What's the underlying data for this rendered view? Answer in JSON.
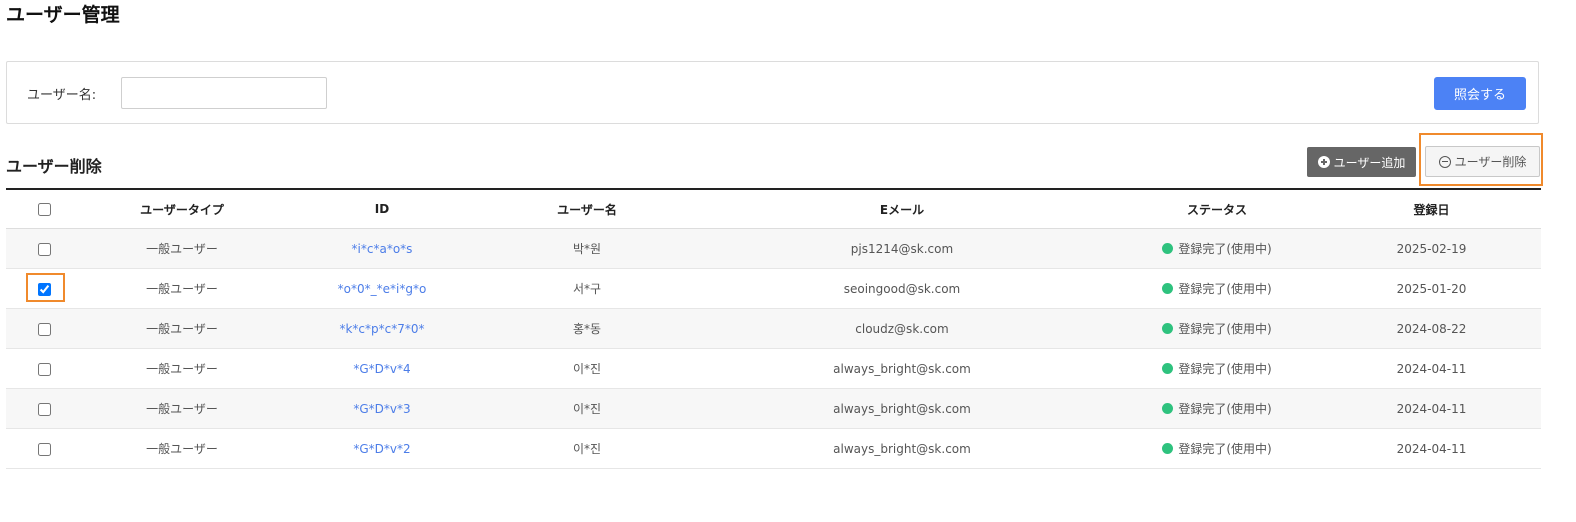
{
  "page_title": "ユーザー管理",
  "search": {
    "label": "ユーザー名:",
    "value": "",
    "placeholder": "",
    "button_label": "照会する"
  },
  "section": {
    "title": "ユーザー削除",
    "add_button_label": "ユーザー追加",
    "delete_button_label": "ユーザー削除"
  },
  "table": {
    "headers": {
      "user_type": "ユーザータイプ",
      "id": "ID",
      "user_name": "ユーザー名",
      "email": "Eメール",
      "status": "ステータス",
      "registered": "登録日"
    },
    "rows": [
      {
        "checked": false,
        "user_type": "一般ユーザー",
        "id": "*i*c*a*o*s",
        "user_name": "박*원",
        "email": "pjs1214@sk.com",
        "status": "登録完了(使用中)",
        "registered": "2025-02-19"
      },
      {
        "checked": true,
        "user_type": "一般ユーザー",
        "id": "*o*0*_*e*i*g*o",
        "user_name": "서*구",
        "email": "seoingood@sk.com",
        "status": "登録完了(使用中)",
        "registered": "2025-01-20"
      },
      {
        "checked": false,
        "user_type": "一般ユーザー",
        "id": "*k*c*p*c*7*0*",
        "user_name": "홍*동",
        "email": "cloudz@sk.com",
        "status": "登録完了(使用中)",
        "registered": "2024-08-22"
      },
      {
        "checked": false,
        "user_type": "一般ユーザー",
        "id": "*G*D*v*4",
        "user_name": "이*진",
        "email": "always_bright@sk.com",
        "status": "登録完了(使用中)",
        "registered": "2024-04-11"
      },
      {
        "checked": false,
        "user_type": "一般ユーザー",
        "id": "*G*D*v*3",
        "user_name": "이*진",
        "email": "always_bright@sk.com",
        "status": "登録完了(使用中)",
        "registered": "2024-04-11"
      },
      {
        "checked": false,
        "user_type": "一般ユーザー",
        "id": "*G*D*v*2",
        "user_name": "이*진",
        "email": "always_bright@sk.com",
        "status": "登録完了(使用中)",
        "registered": "2024-04-11"
      }
    ]
  },
  "colors": {
    "primary_button": "#4c82f5",
    "status_active": "#2ec27e",
    "highlight": "#f08a2c",
    "link": "#4c7de8"
  }
}
